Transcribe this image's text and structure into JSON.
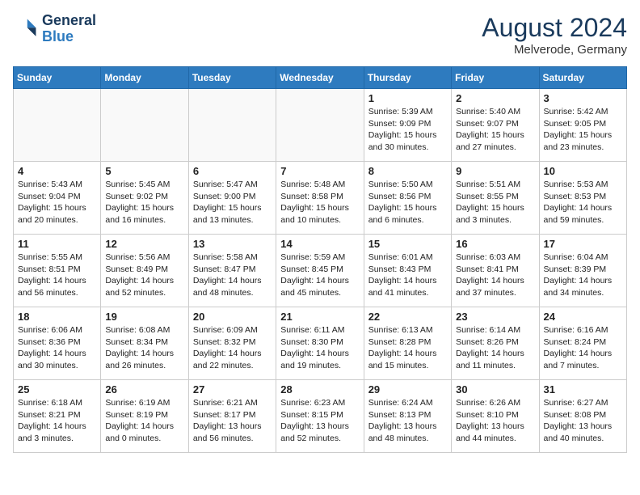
{
  "header": {
    "logo_line1": "General",
    "logo_line2": "Blue",
    "month_year": "August 2024",
    "location": "Melverode, Germany"
  },
  "weekdays": [
    "Sunday",
    "Monday",
    "Tuesday",
    "Wednesday",
    "Thursday",
    "Friday",
    "Saturday"
  ],
  "weeks": [
    [
      {
        "day": "",
        "info": ""
      },
      {
        "day": "",
        "info": ""
      },
      {
        "day": "",
        "info": ""
      },
      {
        "day": "",
        "info": ""
      },
      {
        "day": "1",
        "info": "Sunrise: 5:39 AM\nSunset: 9:09 PM\nDaylight: 15 hours\nand 30 minutes."
      },
      {
        "day": "2",
        "info": "Sunrise: 5:40 AM\nSunset: 9:07 PM\nDaylight: 15 hours\nand 27 minutes."
      },
      {
        "day": "3",
        "info": "Sunrise: 5:42 AM\nSunset: 9:05 PM\nDaylight: 15 hours\nand 23 minutes."
      }
    ],
    [
      {
        "day": "4",
        "info": "Sunrise: 5:43 AM\nSunset: 9:04 PM\nDaylight: 15 hours\nand 20 minutes."
      },
      {
        "day": "5",
        "info": "Sunrise: 5:45 AM\nSunset: 9:02 PM\nDaylight: 15 hours\nand 16 minutes."
      },
      {
        "day": "6",
        "info": "Sunrise: 5:47 AM\nSunset: 9:00 PM\nDaylight: 15 hours\nand 13 minutes."
      },
      {
        "day": "7",
        "info": "Sunrise: 5:48 AM\nSunset: 8:58 PM\nDaylight: 15 hours\nand 10 minutes."
      },
      {
        "day": "8",
        "info": "Sunrise: 5:50 AM\nSunset: 8:56 PM\nDaylight: 15 hours\nand 6 minutes."
      },
      {
        "day": "9",
        "info": "Sunrise: 5:51 AM\nSunset: 8:55 PM\nDaylight: 15 hours\nand 3 minutes."
      },
      {
        "day": "10",
        "info": "Sunrise: 5:53 AM\nSunset: 8:53 PM\nDaylight: 14 hours\nand 59 minutes."
      }
    ],
    [
      {
        "day": "11",
        "info": "Sunrise: 5:55 AM\nSunset: 8:51 PM\nDaylight: 14 hours\nand 56 minutes."
      },
      {
        "day": "12",
        "info": "Sunrise: 5:56 AM\nSunset: 8:49 PM\nDaylight: 14 hours\nand 52 minutes."
      },
      {
        "day": "13",
        "info": "Sunrise: 5:58 AM\nSunset: 8:47 PM\nDaylight: 14 hours\nand 48 minutes."
      },
      {
        "day": "14",
        "info": "Sunrise: 5:59 AM\nSunset: 8:45 PM\nDaylight: 14 hours\nand 45 minutes."
      },
      {
        "day": "15",
        "info": "Sunrise: 6:01 AM\nSunset: 8:43 PM\nDaylight: 14 hours\nand 41 minutes."
      },
      {
        "day": "16",
        "info": "Sunrise: 6:03 AM\nSunset: 8:41 PM\nDaylight: 14 hours\nand 37 minutes."
      },
      {
        "day": "17",
        "info": "Sunrise: 6:04 AM\nSunset: 8:39 PM\nDaylight: 14 hours\nand 34 minutes."
      }
    ],
    [
      {
        "day": "18",
        "info": "Sunrise: 6:06 AM\nSunset: 8:36 PM\nDaylight: 14 hours\nand 30 minutes."
      },
      {
        "day": "19",
        "info": "Sunrise: 6:08 AM\nSunset: 8:34 PM\nDaylight: 14 hours\nand 26 minutes."
      },
      {
        "day": "20",
        "info": "Sunrise: 6:09 AM\nSunset: 8:32 PM\nDaylight: 14 hours\nand 22 minutes."
      },
      {
        "day": "21",
        "info": "Sunrise: 6:11 AM\nSunset: 8:30 PM\nDaylight: 14 hours\nand 19 minutes."
      },
      {
        "day": "22",
        "info": "Sunrise: 6:13 AM\nSunset: 8:28 PM\nDaylight: 14 hours\nand 15 minutes."
      },
      {
        "day": "23",
        "info": "Sunrise: 6:14 AM\nSunset: 8:26 PM\nDaylight: 14 hours\nand 11 minutes."
      },
      {
        "day": "24",
        "info": "Sunrise: 6:16 AM\nSunset: 8:24 PM\nDaylight: 14 hours\nand 7 minutes."
      }
    ],
    [
      {
        "day": "25",
        "info": "Sunrise: 6:18 AM\nSunset: 8:21 PM\nDaylight: 14 hours\nand 3 minutes."
      },
      {
        "day": "26",
        "info": "Sunrise: 6:19 AM\nSunset: 8:19 PM\nDaylight: 14 hours\nand 0 minutes."
      },
      {
        "day": "27",
        "info": "Sunrise: 6:21 AM\nSunset: 8:17 PM\nDaylight: 13 hours\nand 56 minutes."
      },
      {
        "day": "28",
        "info": "Sunrise: 6:23 AM\nSunset: 8:15 PM\nDaylight: 13 hours\nand 52 minutes."
      },
      {
        "day": "29",
        "info": "Sunrise: 6:24 AM\nSunset: 8:13 PM\nDaylight: 13 hours\nand 48 minutes."
      },
      {
        "day": "30",
        "info": "Sunrise: 6:26 AM\nSunset: 8:10 PM\nDaylight: 13 hours\nand 44 minutes."
      },
      {
        "day": "31",
        "info": "Sunrise: 6:27 AM\nSunset: 8:08 PM\nDaylight: 13 hours\nand 40 minutes."
      }
    ]
  ]
}
